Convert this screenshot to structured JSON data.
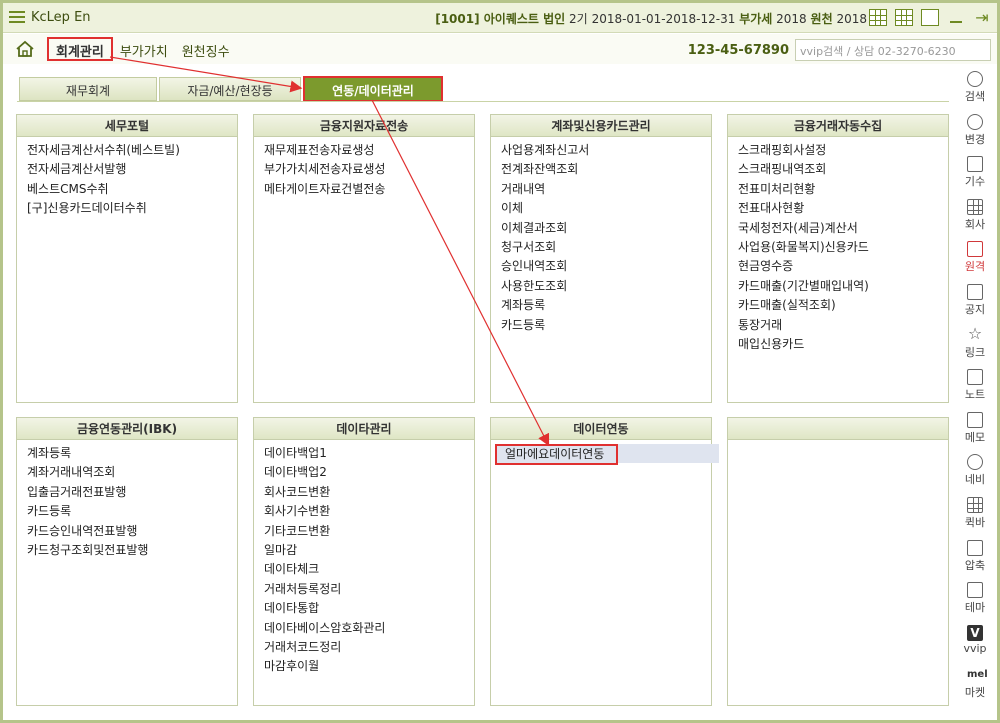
{
  "app": {
    "title": "KcLep En",
    "company_info": "[1001] 아이퀘스트 법인",
    "period_label": "2기",
    "period": "2018-01-01-2018-12-31",
    "vat_label": "부가세",
    "vat_year": "2018",
    "withholding_label": "원천",
    "withholding_year": "2018"
  },
  "menubar": {
    "items": [
      "회계관리",
      "부가가치",
      "원천징수"
    ],
    "active_index": 0,
    "business_no": "123-45-67890",
    "search_placeholder": "vvip검색 / 상담 02-3270-6230"
  },
  "tabs": [
    {
      "label": "재무회계"
    },
    {
      "label": "자금/예산/현장등"
    },
    {
      "label": "연동/데이터관리"
    }
  ],
  "panels": [
    {
      "title": "세무포털",
      "items": [
        "전자세금계산서수취(베스트빌)",
        "전자세금계산서발행",
        "베스트CMS수취",
        "[구]신용카드데이터수취"
      ]
    },
    {
      "title": "금융지원자료전송",
      "items": [
        "재무제표전송자료생성",
        "부가가치세전송자료생성",
        "메타게이트자료건별전송"
      ]
    },
    {
      "title": "계좌및신용카드관리",
      "items": [
        "사업용계좌신고서",
        "전계좌잔액조회",
        "거래내역",
        "이체",
        "이체결과조회",
        "청구서조회",
        "승인내역조회",
        "사용한도조회",
        "계좌등록",
        "카드등록"
      ]
    },
    {
      "title": "금융거래자동수집",
      "items": [
        "스크래핑회사설정",
        "스크래핑내역조회",
        "전표미처리현황",
        "전표대사현황",
        "국세청전자(세금)계산서",
        "사업용(화물복지)신용카드",
        "현금영수증",
        "카드매출(기간별매입내역)",
        "카드매출(실적조회)",
        "통장거래",
        "매입신용카드"
      ]
    },
    {
      "title": "금융연동관리(IBK)",
      "items": [
        "계좌등록",
        "계좌거래내역조회",
        "입출금거래전표발행",
        "카드등록",
        "카드승인내역전표발행",
        "카드청구조회및전표발행"
      ]
    },
    {
      "title": "데이타관리",
      "items": [
        "데이타백업1",
        "데이타백업2",
        "회사코드변환",
        "회사기수변환",
        "기타코드변환",
        "일마감",
        "데이타체크",
        "거래처등록정리",
        "데이타통합",
        "데이타베이스암호화관리",
        "거래처코드정리",
        "마감후이월"
      ]
    },
    {
      "title": "데이터연동",
      "items": [
        "얼마에요데이터연동"
      ]
    },
    {
      "title": "",
      "items": []
    }
  ],
  "sidebar": [
    {
      "label": "검색",
      "icon": "search-icon"
    },
    {
      "label": "변경",
      "icon": "users-icon"
    },
    {
      "label": "기수",
      "icon": "calendar-icon"
    },
    {
      "label": "회사",
      "icon": "building-icon"
    },
    {
      "label": "원격",
      "icon": "remote-icon",
      "color": "#d0383a"
    },
    {
      "label": "공지",
      "icon": "notice-icon"
    },
    {
      "label": "링크",
      "icon": "star-icon"
    },
    {
      "label": "노트",
      "icon": "note-icon"
    },
    {
      "label": "메모",
      "icon": "memo-icon"
    },
    {
      "label": "네비",
      "icon": "navi-icon"
    },
    {
      "label": "퀵바",
      "icon": "quickbar-icon"
    },
    {
      "label": "압축",
      "icon": "compress-icon"
    },
    {
      "label": "테마",
      "icon": "theme-icon"
    },
    {
      "label": "vvip",
      "icon": "vvip-icon"
    },
    {
      "label": "마켓",
      "icon": "market-icon"
    }
  ],
  "colors": {
    "accent": "#7c9a2d",
    "highlight_border": "#e03030",
    "arrow": "#e03030"
  }
}
